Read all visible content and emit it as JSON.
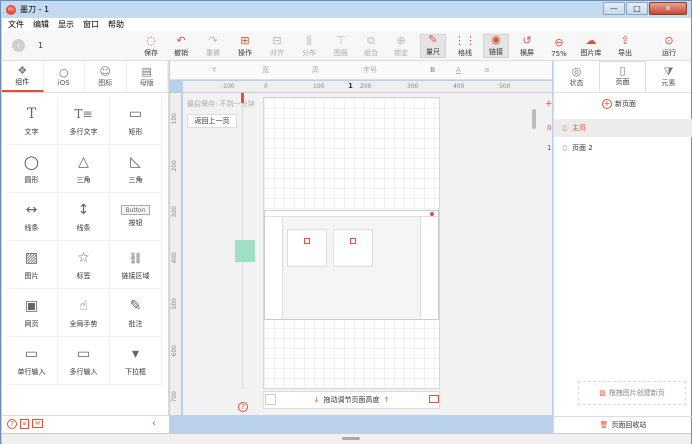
{
  "window": {
    "title": "墨刀 - 1",
    "minimize": "—",
    "maximize": "□",
    "close": "✕"
  },
  "menu": [
    "文件",
    "编辑",
    "显示",
    "窗口",
    "帮助"
  ],
  "toolbar": {
    "page_number": "1",
    "items": [
      {
        "icon": "◌",
        "label": "保存",
        "state": "normal"
      },
      {
        "icon": "↶",
        "label": "撤销",
        "state": "normal"
      },
      {
        "icon": "↷",
        "label": "重做",
        "state": "disabled"
      },
      {
        "icon": "⊞",
        "label": "操作",
        "state": "normal"
      },
      {
        "icon": "⊟",
        "label": "对齐",
        "state": "disabled"
      },
      {
        "icon": "⫼",
        "label": "分布",
        "state": "disabled"
      },
      {
        "icon": "⊤",
        "label": "图层",
        "state": "disabled"
      },
      {
        "icon": "⧉",
        "label": "组合",
        "state": "disabled"
      },
      {
        "icon": "⊕",
        "label": "锁定",
        "state": "disabled"
      },
      {
        "icon": "✎",
        "label": "量尺",
        "state": "active"
      },
      {
        "icon": "⋮⋮",
        "label": "格线",
        "state": "normal"
      },
      {
        "icon": "◉",
        "label": "链接",
        "state": "active"
      },
      {
        "icon": "↺",
        "label": "横屏",
        "state": "normal"
      },
      {
        "icon": "⊖",
        "label": "75%",
        "state": "normal"
      },
      {
        "icon": "☁",
        "label": "图片库",
        "state": "normal"
      },
      {
        "icon": "⇪",
        "label": "导出",
        "state": "normal"
      },
      {
        "icon": "⊙",
        "label": "运行",
        "state": "normal"
      }
    ]
  },
  "left_tabs": [
    {
      "icon": "❖",
      "label": "组件"
    },
    {
      "icon": "",
      "label": "iOS"
    },
    {
      "icon": "☺",
      "label": "图标"
    },
    {
      "icon": "▤",
      "label": "母版"
    }
  ],
  "components": [
    {
      "icon": "T",
      "label": "文字"
    },
    {
      "icon": "T≡",
      "label": "多行文字"
    },
    {
      "icon": "▭",
      "label": "矩形"
    },
    {
      "icon": "○",
      "label": "圆形"
    },
    {
      "icon": "△",
      "label": "三角"
    },
    {
      "icon": "◺",
      "label": "三角"
    },
    {
      "icon": "↔",
      "label": "线条"
    },
    {
      "icon": "↕",
      "label": "线条"
    },
    {
      "icon": "Button",
      "label": "按钮"
    },
    {
      "icon": "▨",
      "label": "图片"
    },
    {
      "icon": "☆",
      "label": "标签"
    },
    {
      "icon": "⛓",
      "label": "链接区域"
    },
    {
      "icon": "▣",
      "label": "网页"
    },
    {
      "icon": "☝",
      "label": "全局手势"
    },
    {
      "icon": "✎",
      "label": "批注"
    },
    {
      "icon": "▭",
      "label": "单行输入"
    },
    {
      "icon": "▭",
      "label": "多行输入"
    },
    {
      "icon": "▾",
      "label": "下拉框"
    }
  ],
  "props": {
    "y": "Y",
    "w": "宽",
    "h": "高",
    "fontsize": "字号",
    "bold": "B",
    "color": "A",
    "align": "≡"
  },
  "ruler": {
    "h_ticks": [
      "-100",
      "0",
      "100",
      "200",
      "300",
      "400",
      "500"
    ],
    "v_ticks": [
      "100",
      "200",
      "300",
      "400",
      "500",
      "600",
      "700"
    ],
    "page_label": "1"
  },
  "canvas": {
    "save_hint": "最后保存: 不到一分钟",
    "back_button": "返回上一页",
    "resize_hint": "拖动调节页面高度",
    "help": "?"
  },
  "right_tabs": [
    {
      "icon": "◎",
      "label": "状态"
    },
    {
      "icon": "▯",
      "label": "页面"
    },
    {
      "icon": "⧩",
      "label": "元素"
    }
  ],
  "pages": {
    "add_label": "新页面",
    "items": [
      {
        "index": "0",
        "name": "主页"
      },
      {
        "index": "1",
        "name": "页面 2"
      }
    ],
    "from_image": "拖拽图片创建新页",
    "recycle": "页面回收站"
  },
  "accent": "#e05038"
}
